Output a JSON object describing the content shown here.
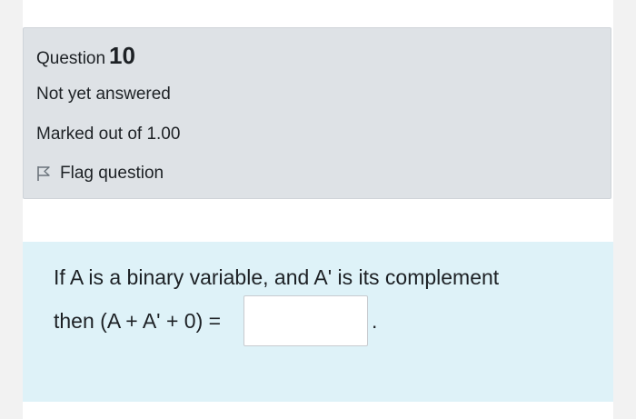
{
  "question_info": {
    "prefix": "Question",
    "number": "10",
    "state": "Not yet answered",
    "grade": "Marked out of 1.00",
    "flag_label": "Flag question"
  },
  "question": {
    "text_line1": "If A is a binary variable, and A' is its complement",
    "text_line2": "then (A + A' + 0) =",
    "answer_value": "",
    "trailing": "."
  },
  "icons": {
    "flag": "flag-outline-icon"
  },
  "colors": {
    "info_bg": "#dee2e6",
    "content_bg": "#def2f8",
    "text": "#1d2125"
  }
}
